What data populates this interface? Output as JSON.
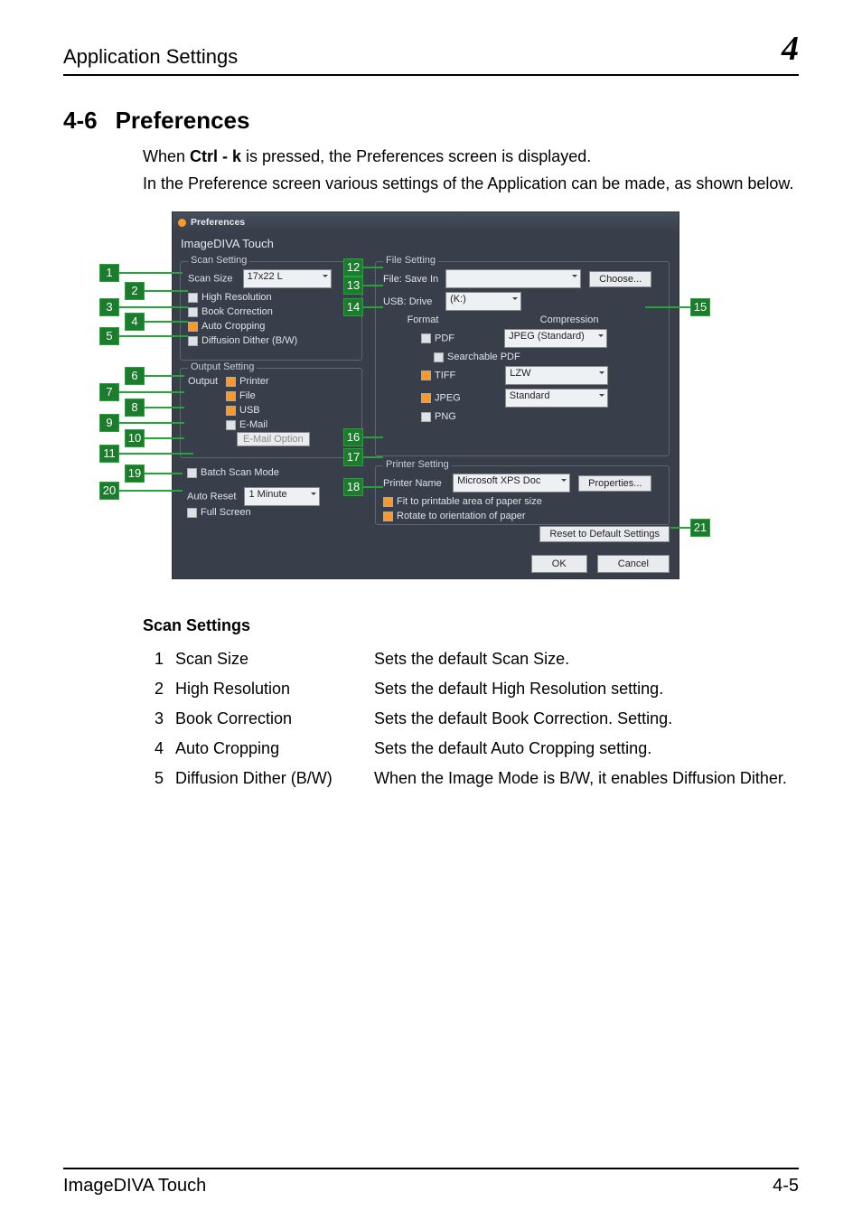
{
  "header": {
    "title": "Application Settings",
    "chapter_num": "4"
  },
  "section": {
    "number": "4-6",
    "title": "Preferences"
  },
  "intro": {
    "p1_a": "When ",
    "p1_b": "Ctrl - k",
    "p1_c": " is pressed, the Preferences screen is displayed.",
    "p2": "In the Preference screen various settings of the Application can be made, as shown below."
  },
  "pref": {
    "titlebar": "Preferences",
    "window_title": "ImageDIVA Touch",
    "scan": {
      "legend": "Scan Setting",
      "scan_size_label": "Scan Size",
      "scan_size_value": "17x22 L",
      "high_res": "High Resolution",
      "book_corr": "Book Correction",
      "auto_crop": "Auto Cropping",
      "dither": "Diffusion Dither (B/W)"
    },
    "output": {
      "legend": "Output Setting",
      "output_label": "Output",
      "printer": "Printer",
      "file": "File",
      "usb": "USB",
      "email": "E-Mail",
      "email_option": "E-Mail Option"
    },
    "batch": "Batch Scan Mode",
    "auto_reset_label": "Auto Reset",
    "auto_reset_value": "1 Minute",
    "full_screen": "Full Screen",
    "file": {
      "legend": "File Setting",
      "save_in": "File: Save In",
      "choose": "Choose...",
      "usb_drive": "USB: Drive",
      "usb_value": "(K:)",
      "format": "Format",
      "compression": "Compression",
      "pdf": "PDF",
      "searchable": "Searchable PDF",
      "tiff": "TIFF",
      "jpeg": "JPEG",
      "png": "PNG",
      "jpeg_std": "JPEG (Standard)",
      "lzw": "LZW",
      "standard": "Standard"
    },
    "printer": {
      "legend": "Printer Setting",
      "name_label": "Printer Name",
      "name_value": "Microsoft XPS Doc",
      "properties": "Properties...",
      "fit": "Fit to printable area of paper size",
      "rotate": "Rotate to orientation of paper"
    },
    "reset": "Reset to Default Settings",
    "ok": "OK",
    "cancel": "Cancel"
  },
  "callouts": {
    "c1": "1",
    "c2": "2",
    "c3": "3",
    "c4": "4",
    "c5": "5",
    "c6": "6",
    "c7": "7",
    "c8": "8",
    "c9": "9",
    "c10": "10",
    "c11": "11",
    "c12": "12",
    "c13": "13",
    "c14": "14",
    "c15": "15",
    "c16": "16",
    "c17": "17",
    "c18": "18",
    "c19": "19",
    "c20": "20",
    "c21": "21"
  },
  "scan_settings": {
    "heading": "Scan Settings",
    "rows": [
      {
        "n": "1",
        "name": "Scan Size",
        "desc": "Sets the default Scan Size."
      },
      {
        "n": "2",
        "name": "High Resolution",
        "desc": "Sets the default High Resolution setting."
      },
      {
        "n": "3",
        "name": "Book Correction",
        "desc": "Sets the default Book Correction. Setting."
      },
      {
        "n": "4",
        "name": "Auto Cropping",
        "desc": "Sets the default Auto Cropping setting."
      },
      {
        "n": "5",
        "name": "Diffusion Dither (B/W)",
        "desc": "When the Image Mode is B/W, it enables Diffusion Dither."
      }
    ]
  },
  "footer": {
    "product": "ImageDIVA Touch",
    "page": "4-5"
  }
}
